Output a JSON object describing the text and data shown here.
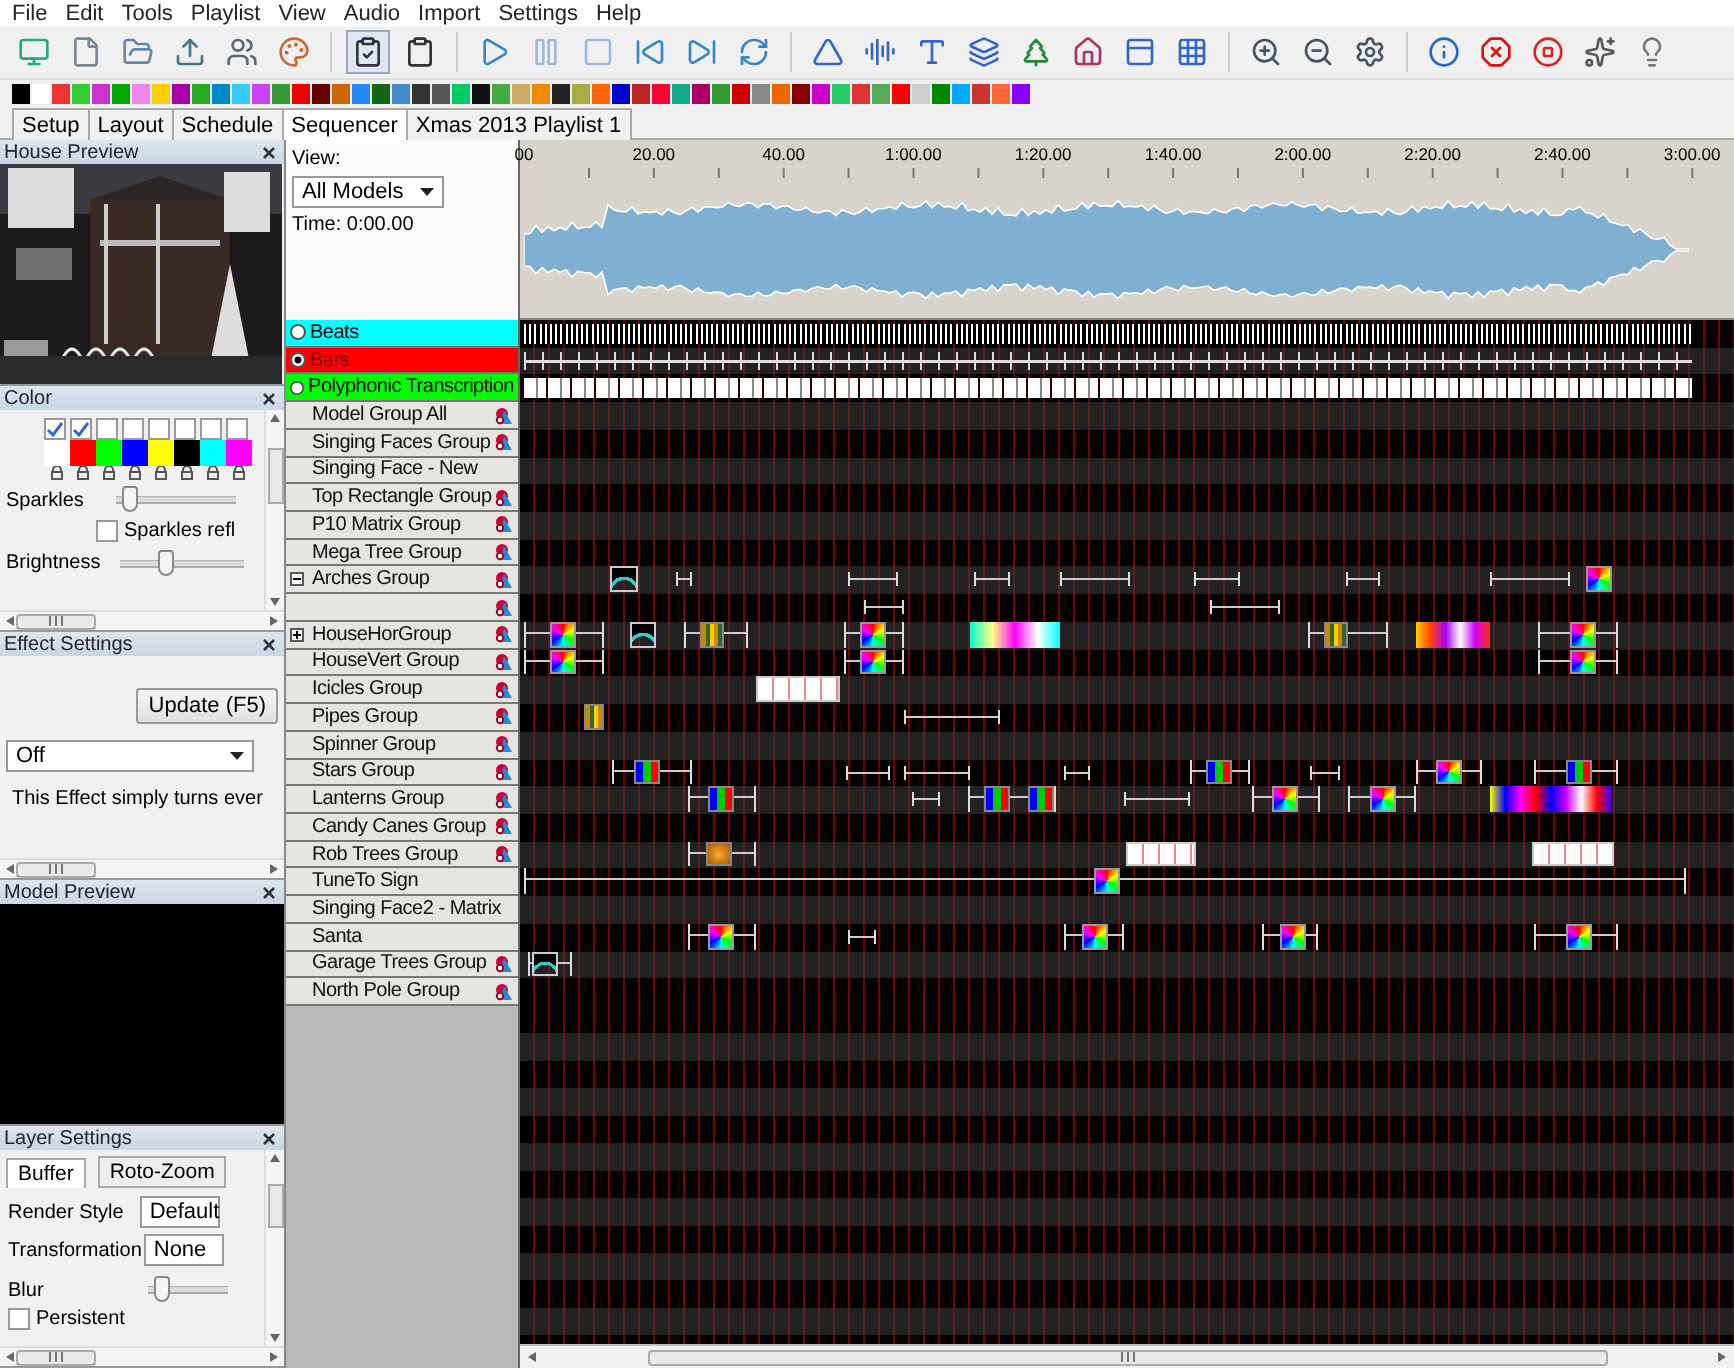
{
  "menu": [
    "File",
    "Edit",
    "Tools",
    "Playlist",
    "View",
    "Audio",
    "Import",
    "Settings",
    "Help"
  ],
  "tabs": [
    {
      "label": "Setup",
      "selected": false
    },
    {
      "label": "Layout",
      "selected": false
    },
    {
      "label": "Schedule",
      "selected": false
    },
    {
      "label": "Sequencer",
      "selected": true
    },
    {
      "label": "Xmas 2013 Playlist 1",
      "selected": false
    }
  ],
  "house_preview": {
    "title": "House Preview"
  },
  "color_panel": {
    "title": "Color",
    "palette": [
      {
        "color": "#ffffff",
        "checked": true
      },
      {
        "color": "#ff0000",
        "checked": true
      },
      {
        "color": "#00ff00",
        "checked": false
      },
      {
        "color": "#0000ff",
        "checked": false
      },
      {
        "color": "#ffff00",
        "checked": false
      },
      {
        "color": "#000000",
        "checked": false
      },
      {
        "color": "#00ffff",
        "checked": false
      },
      {
        "color": "#ff00ff",
        "checked": false
      }
    ],
    "sparkles": {
      "label": "Sparkles",
      "level": 0.05
    },
    "sparkles_reflect": {
      "label": "Sparkles refl",
      "checked": false
    },
    "brightness": {
      "label": "Brightness",
      "level": 0.35
    }
  },
  "effect_settings": {
    "title": "Effect Settings",
    "update_button": "Update (F5)",
    "effect": "Off",
    "description": "This Effect simply turns ever"
  },
  "model_preview": {
    "title": "Model Preview"
  },
  "layer_settings": {
    "title": "Layer Settings",
    "tabs": [
      {
        "label": "Buffer",
        "selected": true
      },
      {
        "label": "Roto-Zoom",
        "selected": false
      }
    ],
    "render_style": {
      "label": "Render Style",
      "value": "Default"
    },
    "transformation": {
      "label": "Transformation",
      "value": "None"
    },
    "blur": {
      "label": "Blur",
      "level": 0.1
    },
    "persistent": {
      "label": "Persistent",
      "checked": false
    }
  },
  "sequencer": {
    "view_label": "View:",
    "view": "All Models",
    "time": "Time: 0:00.00",
    "ruler": [
      "00",
      "20.00",
      "40.00",
      "1:00.00",
      "1:20.00",
      "1:40.00",
      "2:00.00",
      "2:20.00",
      "2:40.00",
      "3:00.00"
    ],
    "timing_tracks": [
      {
        "name": "Beats",
        "kind": "beats",
        "color": "#00ffff",
        "selected": false
      },
      {
        "name": "Bars",
        "kind": "bars",
        "color": "#ff0000",
        "selected": true
      },
      {
        "name": "Polyphonic Transcription",
        "kind": "notes",
        "color": "#00ff00",
        "selected": false
      }
    ],
    "models": [
      {
        "name": "Model Group All",
        "icon": true
      },
      {
        "name": "Singing Faces Group",
        "icon": true
      },
      {
        "name": "Singing Face - New",
        "icon": false
      },
      {
        "name": "Top Rectangle Group",
        "icon": true
      },
      {
        "name": "P10 Matrix Group",
        "icon": true
      },
      {
        "name": "Mega Tree Group",
        "icon": true
      },
      {
        "name": "Arches Group",
        "icon": true,
        "expanded": true
      },
      {
        "icon": true
      },
      {
        "name": "HouseHorGroup",
        "icon": true,
        "expanded": false
      },
      {
        "name": "HouseVert Group",
        "icon": true
      },
      {
        "name": "Icicles Group",
        "icon": true
      },
      {
        "name": "Pipes Group",
        "icon": true
      },
      {
        "name": "Spinner Group",
        "icon": true
      },
      {
        "name": "Stars Group",
        "icon": true
      },
      {
        "name": "Lanterns Group",
        "icon": true
      },
      {
        "name": "Candy Canes Group",
        "icon": true
      },
      {
        "name": "Rob Trees Group",
        "icon": true
      },
      {
        "name": "TuneTo Sign",
        "icon": false
      },
      {
        "name": "Singing Face2 - Matrix",
        "icon": false
      },
      {
        "name": "Santa",
        "icon": false
      },
      {
        "name": "Garage Trees Group",
        "icon": true
      },
      {
        "name": "North Pole Group",
        "icon": true
      }
    ]
  }
}
